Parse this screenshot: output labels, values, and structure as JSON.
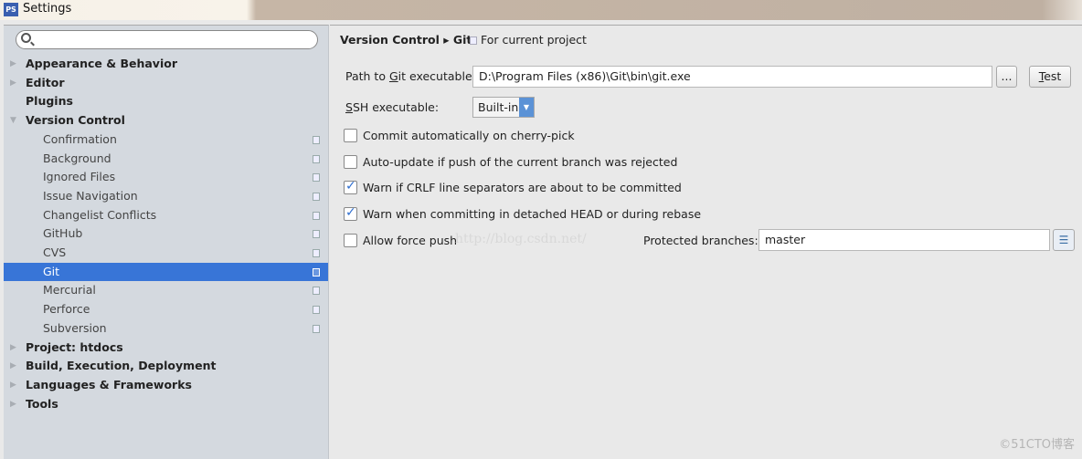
{
  "window": {
    "title": "Settings",
    "logo_text": "PS"
  },
  "sidebar": {
    "search_placeholder": "",
    "items": [
      {
        "label": "Appearance & Behavior",
        "level": 0,
        "expandable": true
      },
      {
        "label": "Editor",
        "level": 0,
        "expandable": true
      },
      {
        "label": "Plugins",
        "level": 0,
        "expandable": false
      },
      {
        "label": "Version Control",
        "level": 0,
        "expandable": true,
        "expanded": true
      },
      {
        "label": "Confirmation",
        "level": 1
      },
      {
        "label": "Background",
        "level": 1
      },
      {
        "label": "Ignored Files",
        "level": 1
      },
      {
        "label": "Issue Navigation",
        "level": 1
      },
      {
        "label": "Changelist Conflicts",
        "level": 1
      },
      {
        "label": "GitHub",
        "level": 1
      },
      {
        "label": "CVS",
        "level": 1
      },
      {
        "label": "Git",
        "level": 1,
        "selected": true
      },
      {
        "label": "Mercurial",
        "level": 1
      },
      {
        "label": "Perforce",
        "level": 1
      },
      {
        "label": "Subversion",
        "level": 1
      },
      {
        "label": "Project: htdocs",
        "level": 0,
        "expandable": true
      },
      {
        "label": "Build, Execution, Deployment",
        "level": 0,
        "expandable": true
      },
      {
        "label": "Languages & Frameworks",
        "level": 0,
        "expandable": true
      },
      {
        "label": "Tools",
        "level": 0,
        "expandable": true
      }
    ]
  },
  "main": {
    "breadcrumb": "Version Control ▸ Git",
    "scope": "For current project",
    "git_path_label_pre": "Path to ",
    "git_path_label_u": "G",
    "git_path_label_post": "it executable:",
    "git_path_value": "D:\\Program Files (x86)\\Git\\bin\\git.exe",
    "browse_label": "...",
    "test_label_u": "T",
    "test_label_post": "est",
    "ssh_label_u": "S",
    "ssh_label_post": "SH executable:",
    "ssh_value": "Built-in",
    "checkboxes": [
      {
        "label": "Commit automatically on cherry-pick",
        "checked": false
      },
      {
        "label": "Auto-update if push of the current branch was rejected",
        "checked": false
      },
      {
        "label": "Warn if CRLF line separators are about to be committed",
        "checked": true
      },
      {
        "label": "Warn when committing in detached HEAD or during rebase",
        "checked": true
      },
      {
        "label": "Allow force push",
        "checked": false
      }
    ],
    "protected_label": "Protected branches:",
    "protected_value": "master"
  },
  "watermarks": {
    "csdn": "http://blog.csdn.net/",
    "cto": "©51CTO博客"
  },
  "colors": {
    "selection": "#3875d7",
    "sidebar_bg": "#d4d9df"
  }
}
